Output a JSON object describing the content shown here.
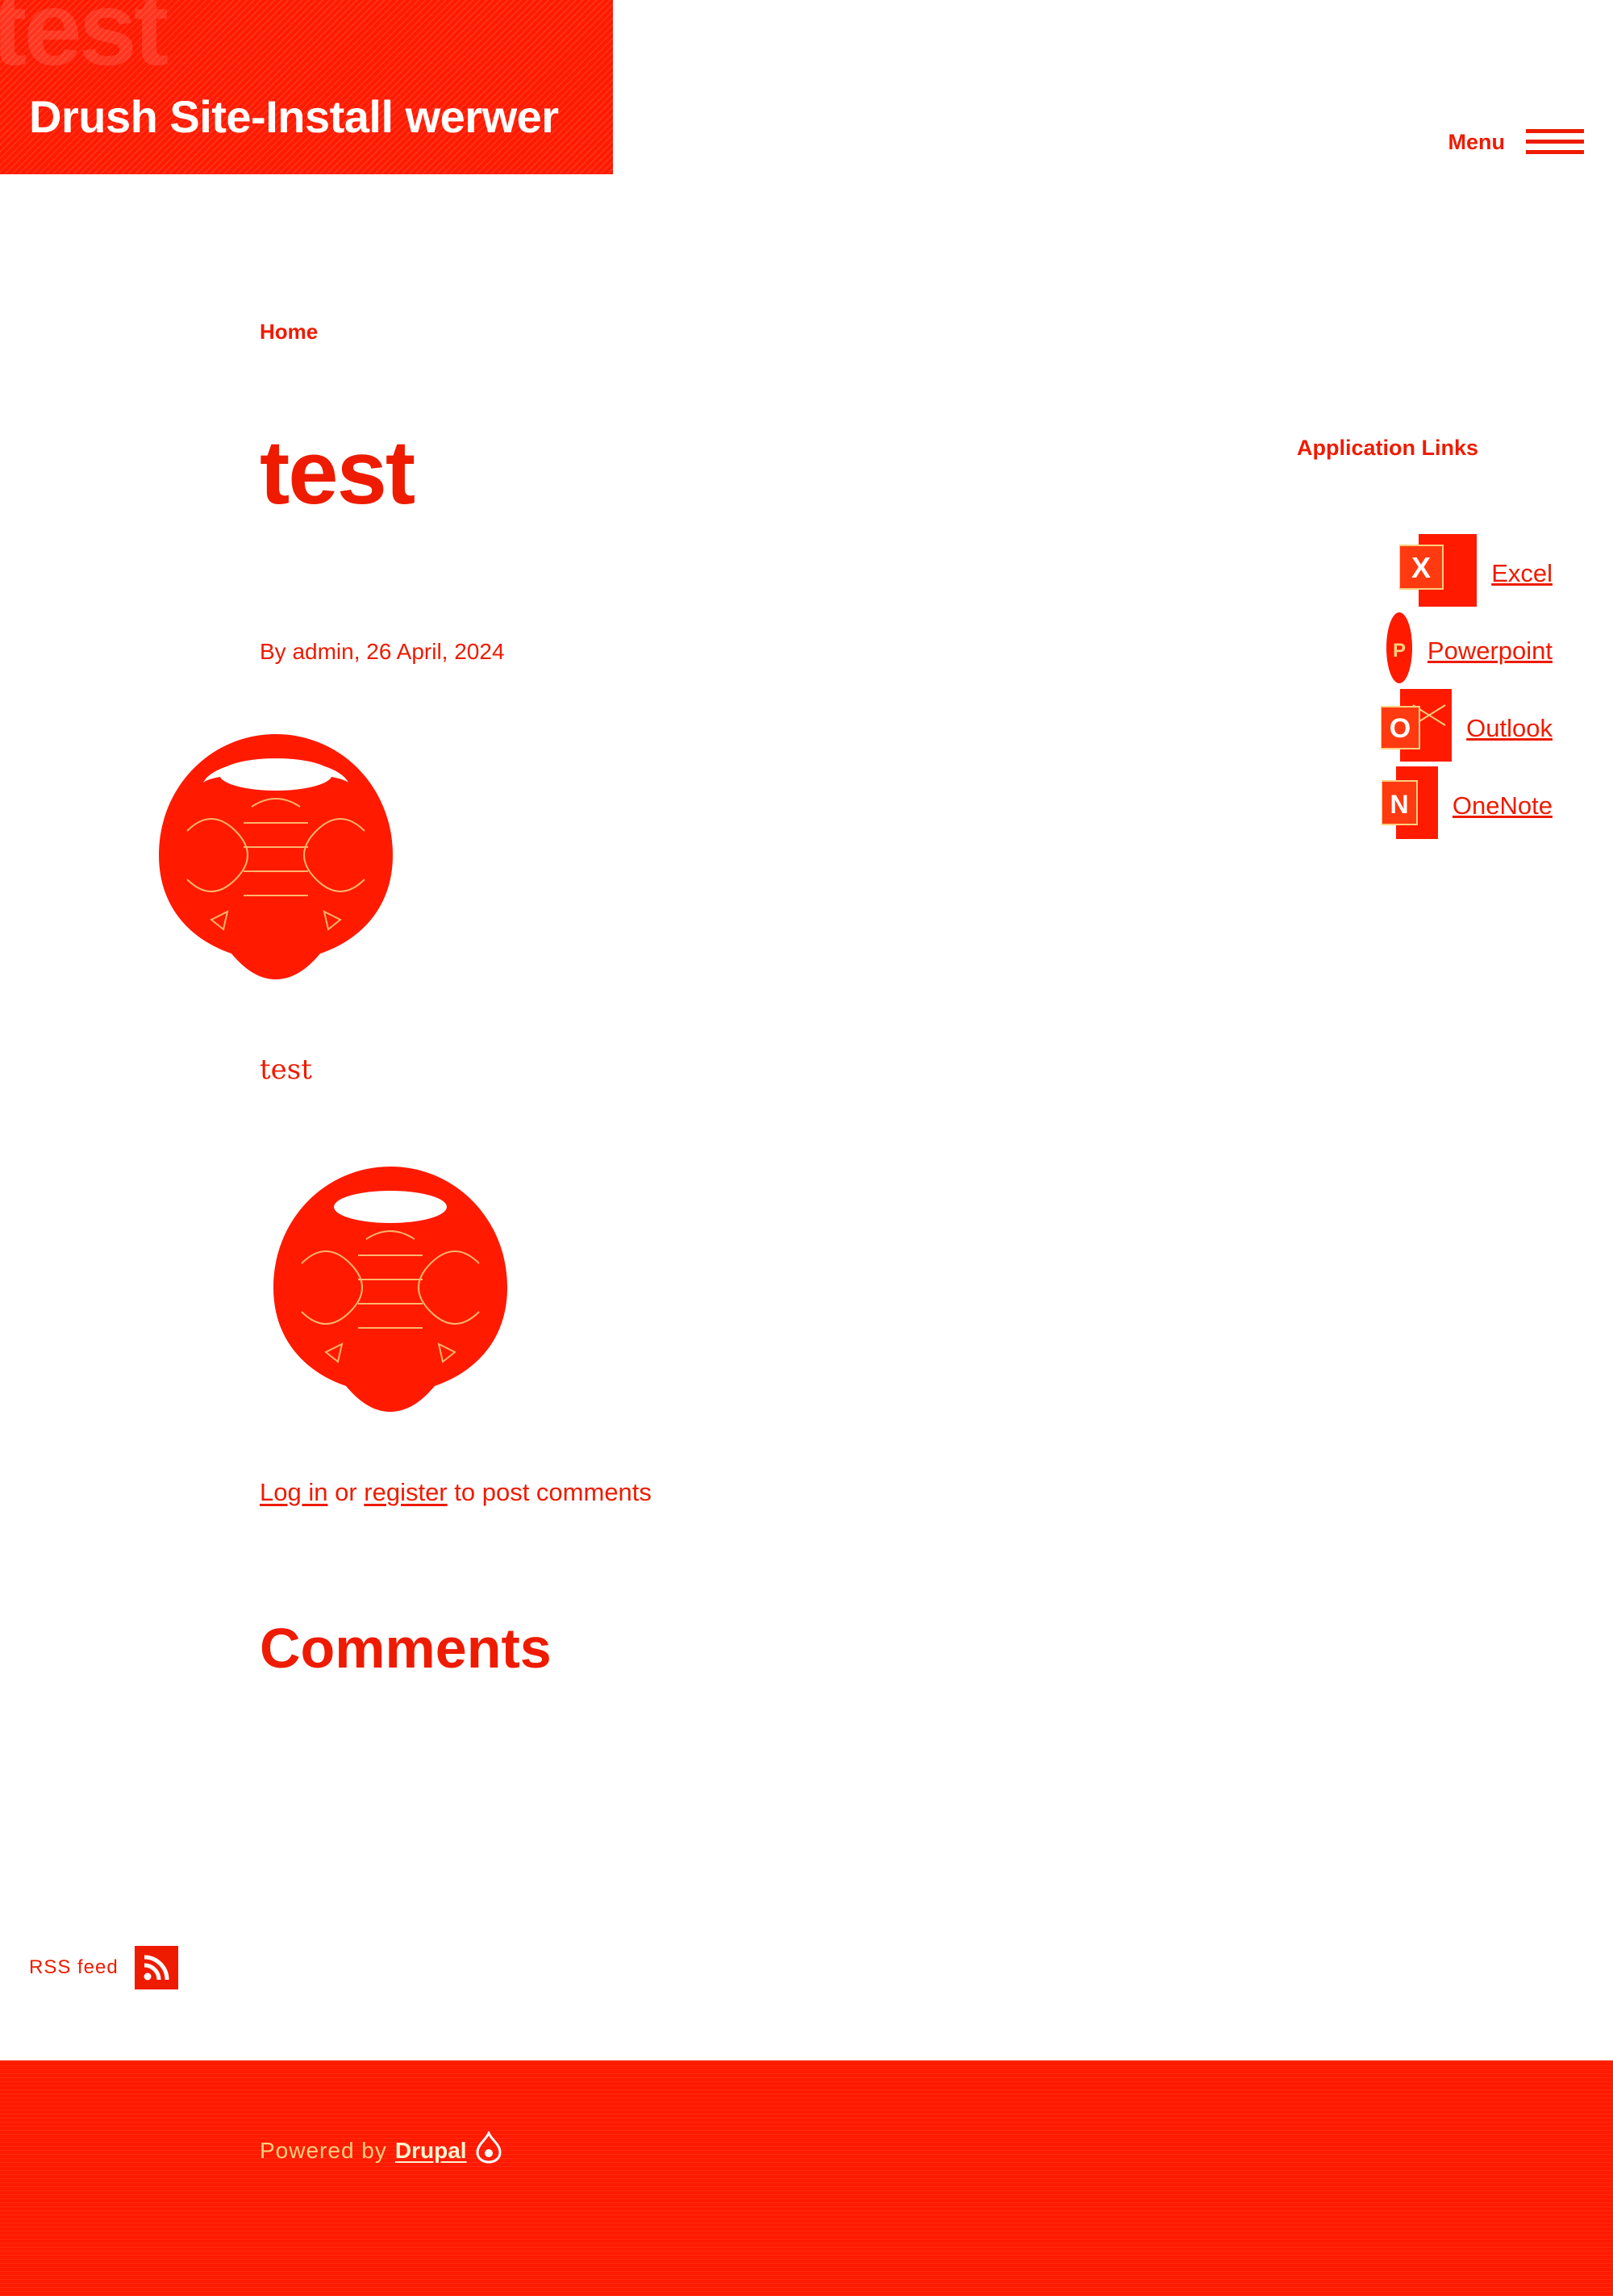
{
  "header": {
    "site_name": "Drush Site-Install werwer",
    "ghost_text": "test",
    "menu_label": "Menu"
  },
  "breadcrumb": {
    "home": "Home"
  },
  "article": {
    "title": "test",
    "byline": "By admin, 26 April, 2024",
    "body": "test"
  },
  "comments": {
    "login_label": "Log in",
    "or_text": " or ",
    "register_label": "register",
    "suffix_text": " to post comments",
    "heading": "Comments"
  },
  "sidebar": {
    "title": "Application Links",
    "links": [
      {
        "label": "Excel",
        "icon": "excel-icon",
        "letter": "X"
      },
      {
        "label": "Powerpoint",
        "icon": "powerpoint-icon",
        "letter": "P"
      },
      {
        "label": "Outlook",
        "icon": "outlook-icon",
        "letter": "O"
      },
      {
        "label": "OneNote",
        "icon": "onenote-icon",
        "letter": "N"
      }
    ]
  },
  "rss": {
    "label": "RSS feed",
    "icon": "rss-icon"
  },
  "footer": {
    "powered_text": "Powered by",
    "drupal_label": "Drupal",
    "drupal_icon": "drupal-drop-icon"
  },
  "colors": {
    "accent": "#ee1b00",
    "header_bg": "#ff1a00",
    "white": "#ffffff"
  }
}
